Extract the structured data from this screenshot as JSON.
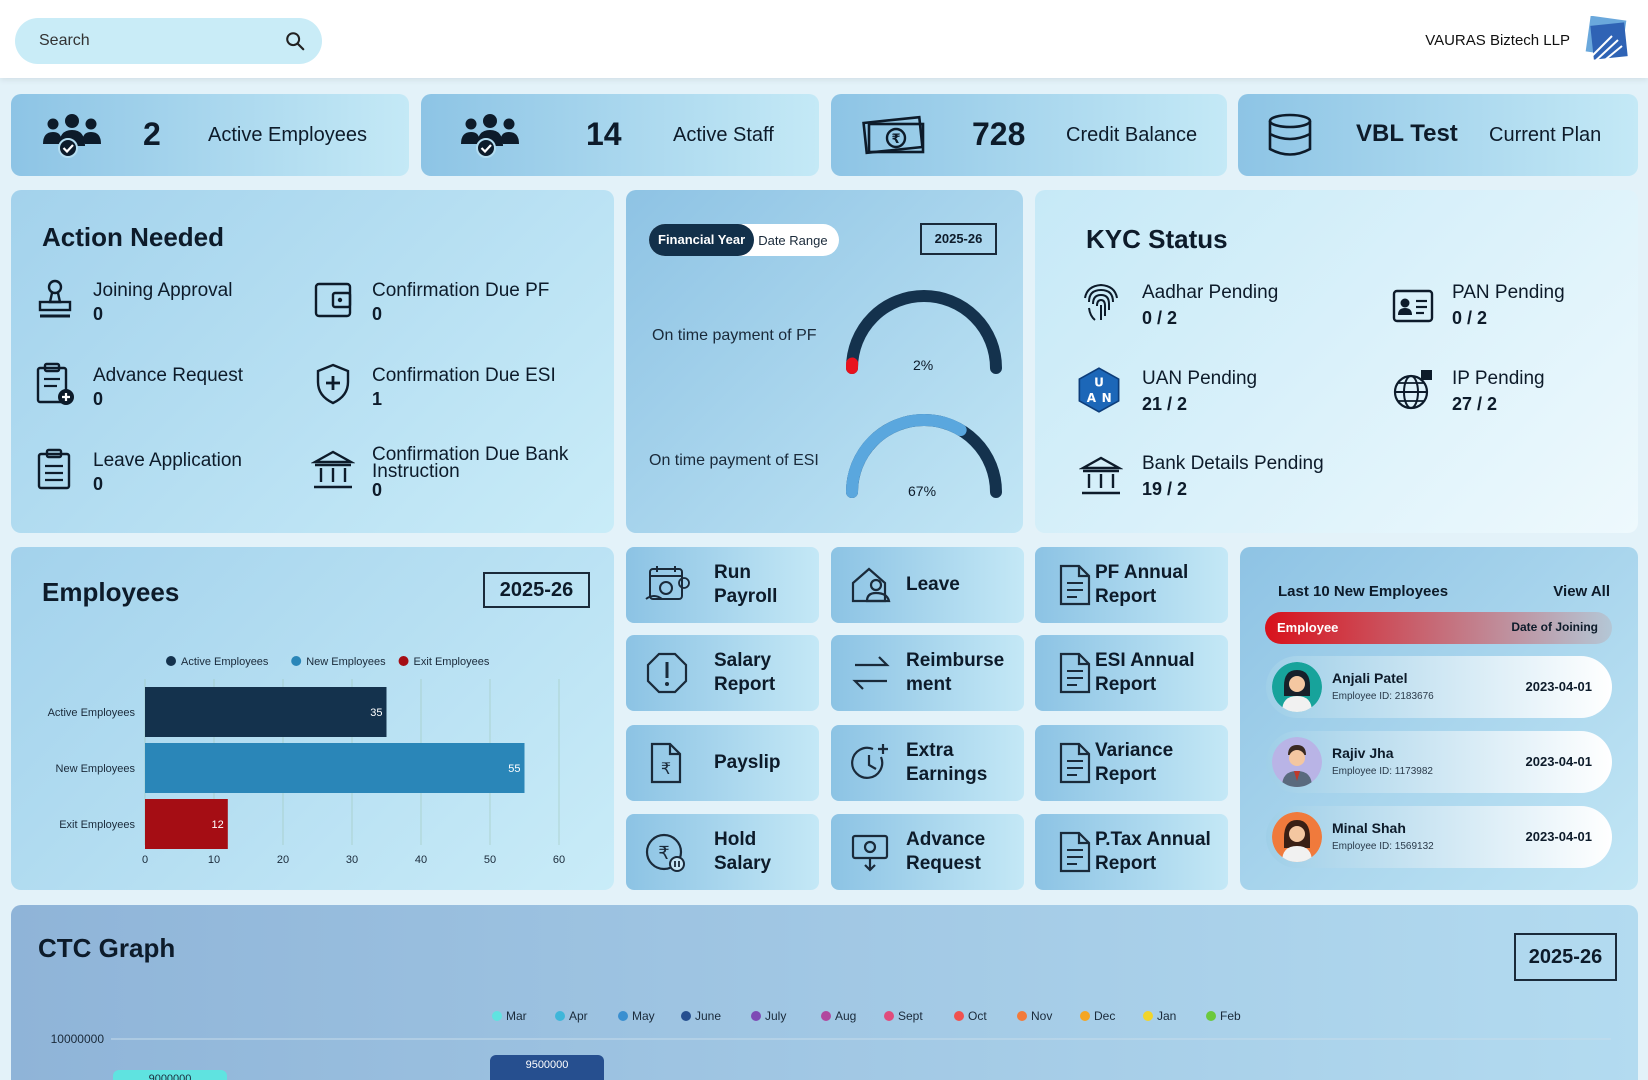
{
  "header": {
    "search_placeholder": "Search",
    "company_name": "VAURAS Biztech LLP"
  },
  "stats": [
    {
      "value": "2",
      "label": "Active Employees",
      "icon": "users-check-icon"
    },
    {
      "value": "14",
      "label": "Active Staff",
      "icon": "users-check-icon"
    },
    {
      "value": "728",
      "label": "Credit Balance",
      "icon": "rupee-banknote-icon"
    },
    {
      "value": "VBL Test",
      "label": "Current Plan",
      "icon": "database-icon"
    }
  ],
  "action_needed": {
    "title": "Action Needed",
    "items": [
      {
        "label": "Joining Approval",
        "value": "0",
        "icon": "stamp-icon"
      },
      {
        "label": "Confirmation Due PF",
        "value": "0",
        "icon": "wallet-icon"
      },
      {
        "label": "Advance Request",
        "value": "0",
        "icon": "clipboard-plus-icon"
      },
      {
        "label": "Confirmation Due ESI",
        "value": "1",
        "icon": "shield-plus-icon"
      },
      {
        "label": "Leave Application",
        "value": "0",
        "icon": "clipboard-list-icon"
      },
      {
        "label": "Confirmation Due Bank Instruction",
        "value": "0",
        "icon": "bank-icon"
      }
    ]
  },
  "payment_gauges": {
    "toggle_active": "Financial Year",
    "toggle_inactive": "Date Range",
    "year": "2025-26",
    "pf_label": "On time payment of PF",
    "pf_percent_text": "2%",
    "pf_fraction": 0.02,
    "esi_label": "On time payment of ESI",
    "esi_percent_text": "67%",
    "esi_fraction": 0.67
  },
  "kyc": {
    "title": "KYC Status",
    "items": [
      {
        "label": "Aadhar Pending",
        "value": "0 / 2",
        "icon": "fingerprint-icon"
      },
      {
        "label": "PAN Pending",
        "value": "0 / 2",
        "icon": "id-card-icon"
      },
      {
        "label": "UAN Pending",
        "value": "21 / 2",
        "icon": "uan-badge-icon"
      },
      {
        "label": "IP Pending",
        "value": "27 / 2",
        "icon": "globe-icon"
      },
      {
        "label": "Bank Details Pending",
        "value": "19 / 2",
        "icon": "bank-icon"
      }
    ]
  },
  "employees_panel": {
    "title": "Employees",
    "year": "2025-26"
  },
  "chart_data": [
    {
      "type": "bar",
      "orientation": "horizontal",
      "categories": [
        "Active Employees",
        "New Employees",
        "Exit Employees"
      ],
      "values": [
        35,
        55,
        12
      ],
      "colors": [
        "#14324d",
        "#2a86b8",
        "#a50d14"
      ],
      "legend": [
        "Active Employees",
        "New Employees",
        "Exit Employees"
      ],
      "xlim": [
        0,
        60
      ],
      "xticks": [
        "0",
        "10",
        "20",
        "30",
        "40",
        "50",
        "60"
      ],
      "grid": true,
      "legend_position": "top"
    },
    {
      "type": "bar",
      "title": "CTC Graph",
      "year": "2025-26",
      "legend": [
        {
          "name": "Mar",
          "color": "#5fe3e0"
        },
        {
          "name": "Apr",
          "color": "#3fb6d9"
        },
        {
          "name": "May",
          "color": "#3a8fd0"
        },
        {
          "name": "June",
          "color": "#264f8f"
        },
        {
          "name": "July",
          "color": "#7e4bb5"
        },
        {
          "name": "Aug",
          "color": "#b1479e"
        },
        {
          "name": "Sept",
          "color": "#e04c7c"
        },
        {
          "name": "Oct",
          "color": "#f0514f"
        },
        {
          "name": "Nov",
          "color": "#f37a3a"
        },
        {
          "name": "Dec",
          "color": "#f5a623"
        },
        {
          "name": "Jan",
          "color": "#f2d52b"
        },
        {
          "name": "Feb",
          "color": "#6cc93d"
        }
      ],
      "ytick_top": "10000000",
      "visible_bars": [
        {
          "label": "9000000",
          "color": "#5fe3e0"
        },
        {
          "label": "9500000",
          "color": "#264f8f"
        }
      ]
    }
  ],
  "quick_actions": [
    {
      "label": "Run Payroll",
      "icon": "payroll-icon"
    },
    {
      "label": "Leave",
      "icon": "home-user-icon"
    },
    {
      "label": "PF Annual Report",
      "icon": "document-icon"
    },
    {
      "label": "Salary Report",
      "icon": "alert-octagon-icon"
    },
    {
      "label": "Reimburse ment",
      "icon": "arrows-exchange-icon"
    },
    {
      "label": "ESI Annual Report",
      "icon": "document-icon"
    },
    {
      "label": "Payslip",
      "icon": "rupee-document-icon"
    },
    {
      "label": "Extra Earnings",
      "icon": "clock-plus-icon"
    },
    {
      "label": "Variance Report",
      "icon": "document-icon"
    },
    {
      "label": "Hold Salary",
      "icon": "rupee-pause-icon"
    },
    {
      "label": "Advance Request",
      "icon": "money-download-icon"
    },
    {
      "label": "P.Tax Annual Report",
      "icon": "document-icon"
    }
  ],
  "new_employees": {
    "title": "Last 10 New Employees",
    "view_all": "View All",
    "col_employee": "Employee",
    "col_date": "Date of Joining",
    "rows": [
      {
        "name": "Anjali Patel",
        "id": "Employee ID: 2183676",
        "date": "2023-04-01"
      },
      {
        "name": "Rajiv Jha",
        "id": "Employee ID: 1173982",
        "date": "2023-04-01"
      },
      {
        "name": "Minal Shah",
        "id": "Employee ID: 1569132",
        "date": "2023-04-01"
      }
    ]
  }
}
